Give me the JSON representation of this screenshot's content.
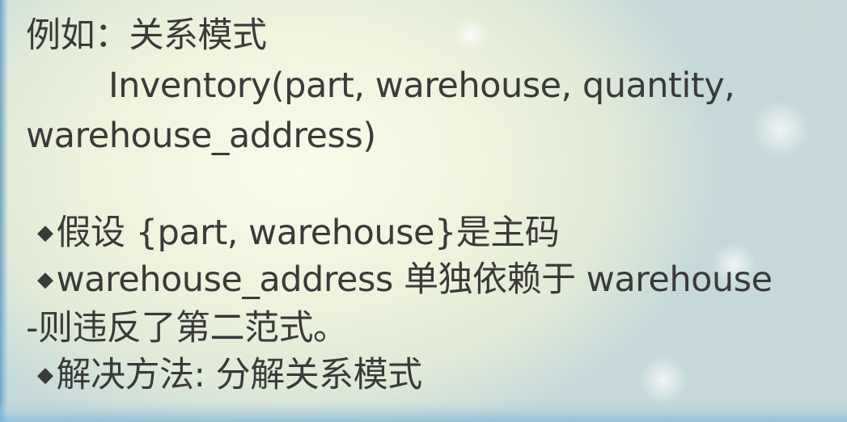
{
  "lines": {
    "example_heading": "例如：关系模式",
    "relation_part1": "Inventory(part, warehouse, quantity,",
    "relation_part2": "warehouse_address)",
    "bullet_symbol": "◆",
    "bullet1": "假设 {part, warehouse}是主码",
    "bullet2": "warehouse_address 单独依赖于 warehouse",
    "continuation": "-则违反了第二范式。",
    "bullet3": "解决方法: 分解关系模式"
  }
}
